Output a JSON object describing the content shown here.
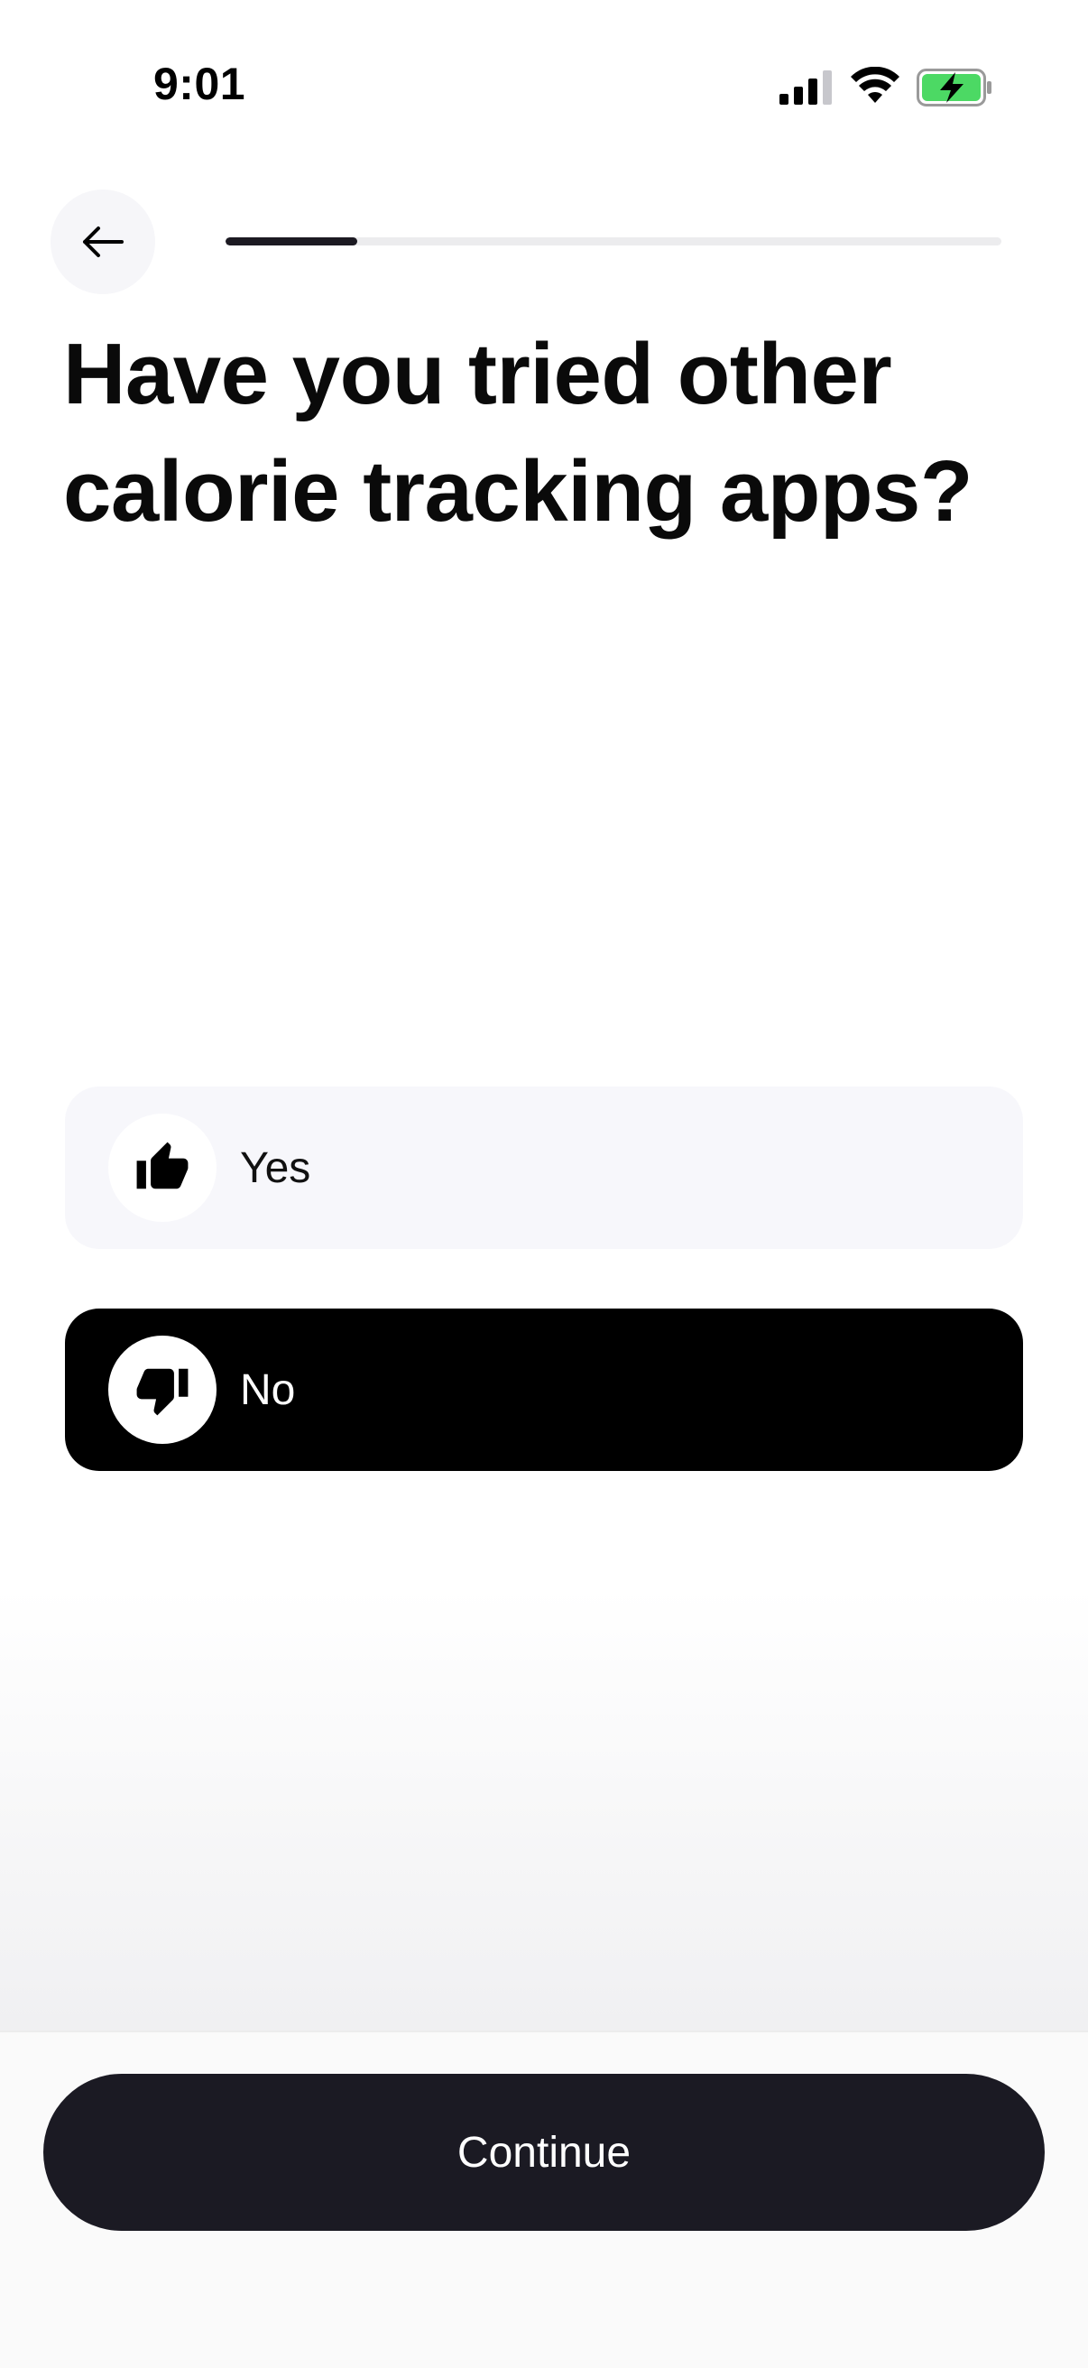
{
  "status_bar": {
    "time": "9:01",
    "icons": [
      "signal-icon",
      "wifi-icon",
      "battery-charging-icon"
    ],
    "battery_color": "#4cd964"
  },
  "header": {
    "back_icon": "arrow-left-icon",
    "progress_fraction": 0.17
  },
  "question": {
    "title": "Have you tried other calorie tracking apps?"
  },
  "options": [
    {
      "label": "Yes",
      "icon": "thumbs-up-icon",
      "selected": false
    },
    {
      "label": "No",
      "icon": "thumbs-down-icon",
      "selected": true
    }
  ],
  "footer": {
    "continue_label": "Continue"
  },
  "colors": {
    "selected_option_bg": "#000000",
    "unselected_option_bg": "#f7f7fb",
    "primary_button_bg": "#1b1a23",
    "progress_fill": "#1c1a22"
  }
}
